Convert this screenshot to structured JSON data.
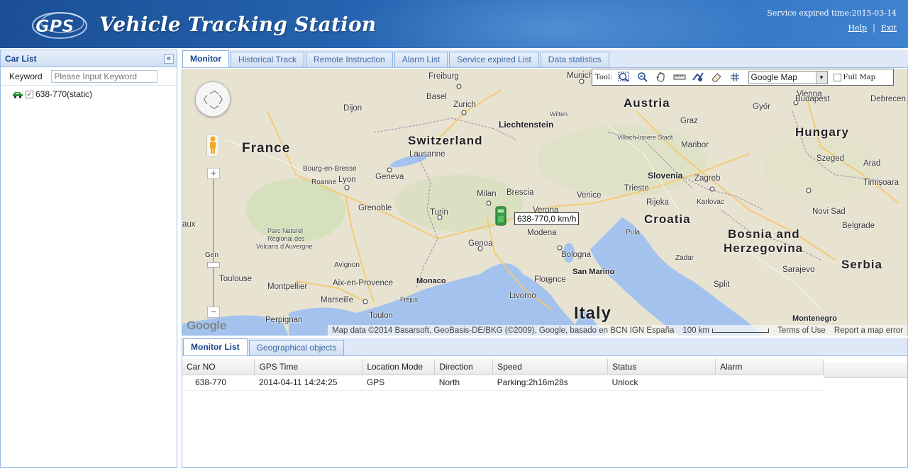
{
  "header": {
    "app_title": "Vehicle Tracking Station",
    "logo_text": "GPS",
    "service_expired": "Service expired time:2015-03-14",
    "help_label": "Help",
    "separator": "|",
    "exit_label": "Exit"
  },
  "sidebar": {
    "title": "Car List",
    "collapse_symbol": "«",
    "keyword_label": "Keyword",
    "keyword_placeholder": "Please Input Keyword",
    "items": [
      {
        "label": "638-770(static)",
        "checked": true,
        "icon": "car-icon"
      }
    ]
  },
  "tabs": [
    {
      "label": "Monitor",
      "active": true
    },
    {
      "label": "Historical Track",
      "active": false
    },
    {
      "label": "Remote Instruction",
      "active": false
    },
    {
      "label": "Alarm List",
      "active": false
    },
    {
      "label": "Service expired List",
      "active": false
    },
    {
      "label": "Data statistics",
      "active": false
    }
  ],
  "map": {
    "tool_label": "Tool:",
    "tools": [
      "zoom-in-area-icon",
      "zoom-out-icon",
      "pan-hand-icon",
      "ruler-icon",
      "measure-area-icon",
      "eraser-icon",
      "grid-icon"
    ],
    "map_type": "Google Map",
    "full_map_label": "Full Map",
    "vehicle_label": "638-770,0 km/h",
    "attribution": "Map data ©2014 Basarsoft, GeoBasis-DE/BKG (©2009), Google, basado en BCN IGN España",
    "scale": "100 km",
    "terms": "Terms of Use",
    "report": "Report a map error",
    "google": "Google",
    "labels": {
      "france": "France",
      "switzerland": "Switzerland",
      "austria": "Austria",
      "hungary": "Hungary",
      "croatia": "Croatia",
      "bosnia1": "Bosnia and",
      "bosnia2": "Herzegovina",
      "serbia": "Serbia",
      "italy": "Italy",
      "slovenia": "Slovenia",
      "liechtenstein": "Liechtenstein",
      "monaco": "Monaco",
      "san_marino": "San Marino",
      "montenegro": "Montenegro",
      "freiburg": "Freiburg",
      "munich": "Munich",
      "basel": "Basel",
      "zurich": "Zurich",
      "dijon": "Dijon",
      "lausanne": "Lausanne",
      "geneva": "Geneva",
      "bourg": "Bourg-en-Bresse",
      "roanne": "Roanne",
      "lyon": "Lyon",
      "grenoble": "Grenoble",
      "milan": "Milan",
      "brescia": "Brescia",
      "verona": "Verona",
      "venice": "Venice",
      "turin": "Turin",
      "modena": "Modena",
      "genoa": "Genoa",
      "bologna": "Bologna",
      "florence": "Florence",
      "livorno": "Livorno",
      "avignon": "Avignon",
      "aix": "Aix-en-Provence",
      "montpellier": "Montpellier",
      "marseille": "Marseille",
      "toulon": "Toulon",
      "toulouse": "Toulouse",
      "perpignan": "Perpignan",
      "frejus": "Fréjus",
      "vienna": "Vienna",
      "budapest": "Budapest",
      "gyor": "Győr",
      "graz": "Graz",
      "maribor": "Maribor",
      "zagreb": "Zagreb",
      "trieste": "Trieste",
      "rijeka": "Rijeka",
      "karlovac": "Karlovac",
      "szeged": "Szeged",
      "arad": "Arad",
      "timisoara": "Timișoara",
      "novi_sad": "Novi Sad",
      "belgrade": "Belgrade",
      "split": "Split",
      "zadar": "Zadar",
      "sarajevo": "Sarajevo",
      "debrecen": "Debrecen",
      "villach": "Villach-Innere Stadt",
      "wilten": "Wilten",
      "parc1": "Parc Naturel",
      "parc2": "Régional des",
      "parc3": "Volcans d'Auvergne",
      "gen": "Gen",
      "aux": "aux",
      "pula": "Pula"
    }
  },
  "bottom": {
    "tabs": [
      {
        "label": "Monitor List",
        "active": true
      },
      {
        "label": "Geographical objects",
        "active": false
      }
    ],
    "columns": [
      "Car NO",
      "GPS Time",
      "Location Mode",
      "Direction",
      "Speed",
      "Status",
      "Alarm"
    ],
    "rows": [
      {
        "car_no": "638-770",
        "gps_time": "2014-04-11 14:24:25",
        "location_mode": "GPS",
        "direction": "North",
        "speed": "Parking:2h16m28s",
        "status": "Unlock",
        "alarm": ""
      }
    ]
  },
  "colors": {
    "header_bg": "#2766b4",
    "panel_border": "#99bbe8",
    "tab_text": "#15428b",
    "sea": "#a3c3ee",
    "land": "#e8e2d1",
    "vehicle": "#3fae4a"
  }
}
